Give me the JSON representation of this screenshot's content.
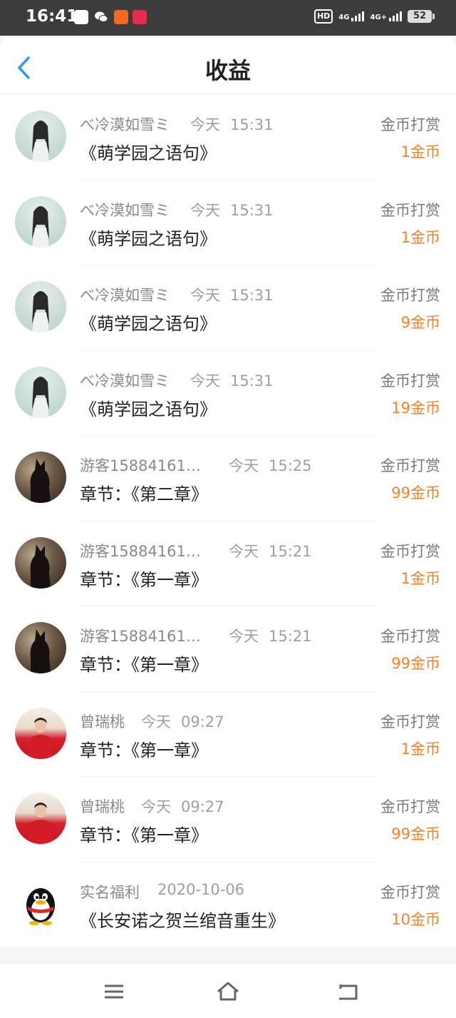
{
  "status_bar": {
    "time": "16:41",
    "hd_label": "HD",
    "hd_sub": "2",
    "net1": "4G",
    "net2": "4G+",
    "battery": "52",
    "notif_colors": [
      "#ffffff",
      "#ffffff",
      "#f06a21",
      "#e8294e"
    ]
  },
  "header": {
    "title": "收益",
    "back_icon": "chevron-left-icon",
    "accent": "#2b9cf2"
  },
  "records": [
    {
      "user": "べ冷漠如雪ミ",
      "day": "今天",
      "time": "15:31",
      "work": "《萌学园之语句》",
      "type": "金币打赏",
      "amount": "1金币",
      "avatar": "girl"
    },
    {
      "user": "べ冷漠如雪ミ",
      "day": "今天",
      "time": "15:31",
      "work": "《萌学园之语句》",
      "type": "金币打赏",
      "amount": "1金币",
      "avatar": "girl"
    },
    {
      "user": "べ冷漠如雪ミ",
      "day": "今天",
      "time": "15:31",
      "work": "《萌学园之语句》",
      "type": "金币打赏",
      "amount": "9金币",
      "avatar": "girl"
    },
    {
      "user": "べ冷漠如雪ミ",
      "day": "今天",
      "time": "15:31",
      "work": "《萌学园之语句》",
      "type": "金币打赏",
      "amount": "19金币",
      "avatar": "girl"
    },
    {
      "user": "游客15884161…",
      "day": "今天",
      "time": "15:25",
      "work": "章节：《第二章》",
      "type": "金币打赏",
      "amount": "99金币",
      "avatar": "dark"
    },
    {
      "user": "游客15884161…",
      "day": "今天",
      "time": "15:21",
      "work": "章节：《第一章》",
      "type": "金币打赏",
      "amount": "1金币",
      "avatar": "dark"
    },
    {
      "user": "游客15884161…",
      "day": "今天",
      "time": "15:21",
      "work": "章节：《第一章》",
      "type": "金币打赏",
      "amount": "99金币",
      "avatar": "dark"
    },
    {
      "user": "曾瑞桃",
      "day": "今天",
      "time": "09:27",
      "work": "章节：《第一章》",
      "type": "金币打赏",
      "amount": "1金币",
      "avatar": "red"
    },
    {
      "user": "曾瑞桃",
      "day": "今天",
      "time": "09:27",
      "work": "章节：《第一章》",
      "type": "金币打赏",
      "amount": "99金币",
      "avatar": "red"
    },
    {
      "user": "实名福利",
      "day": "2020-10-06",
      "time": "",
      "work": "《长安诺之贺兰绾音重生》",
      "type": "金币打赏",
      "amount": "10金币",
      "avatar": "qq"
    }
  ],
  "colors": {
    "amount": "#f5822a"
  },
  "navbar": {
    "icons": [
      "menu-icon",
      "home-icon",
      "back-icon"
    ]
  }
}
